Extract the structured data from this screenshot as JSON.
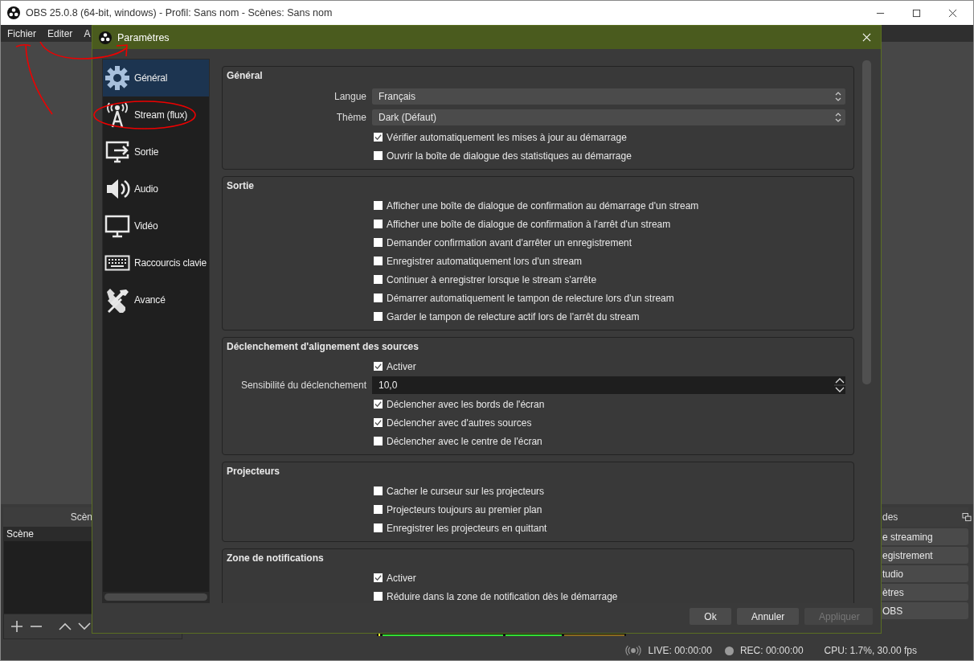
{
  "main_window": {
    "title": "OBS 25.0.8 (64-bit, windows) - Profil: Sans nom - Scènes: Sans nom"
  },
  "menu": [
    "Fichier",
    "Editer",
    "A"
  ],
  "scenes_dock": {
    "title": "Scèn",
    "items": [
      {
        "label": "Scène",
        "selected": false
      }
    ]
  },
  "controls_dock": {
    "title": "des",
    "buttons": [
      "e streaming",
      "egistrement",
      "tudio",
      "ètres",
      "OBS"
    ]
  },
  "status_bar": {
    "live": "LIVE: 00:00:00",
    "rec": "REC: 00:00:00",
    "cpu": "CPU: 1.7%, 30.00 fps"
  },
  "dialog": {
    "title": "Paramètres",
    "sidebar": [
      {
        "label": "Général",
        "selected": true
      },
      {
        "label": "Stream (flux)",
        "selected": false
      },
      {
        "label": "Sortie",
        "selected": false
      },
      {
        "label": "Audio",
        "selected": false
      },
      {
        "label": "Vidéo",
        "selected": false
      },
      {
        "label": "Raccourcis clavie",
        "selected": false
      },
      {
        "label": "Avancé",
        "selected": false
      }
    ],
    "groups": [
      {
        "title": "Général",
        "rows": [
          {
            "kind": "select",
            "label": "Langue",
            "value": "Français"
          },
          {
            "kind": "select",
            "label": "Thème",
            "value": "Dark (Défaut)"
          },
          {
            "kind": "checkbox",
            "label": "Vérifier automatiquement les mises à jour au démarrage",
            "checked": true
          },
          {
            "kind": "checkbox",
            "label": "Ouvrir la boîte de dialogue des statistiques au démarrage",
            "checked": false
          }
        ]
      },
      {
        "title": "Sortie",
        "rows": [
          {
            "kind": "checkbox",
            "label": "Afficher une boîte de dialogue de confirmation au démarrage d'un stream",
            "checked": false
          },
          {
            "kind": "checkbox",
            "label": "Afficher une boîte de dialogue de confirmation à l'arrêt d'un stream",
            "checked": false
          },
          {
            "kind": "checkbox",
            "label": "Demander confirmation avant d'arrêter un enregistrement",
            "checked": false
          },
          {
            "kind": "checkbox",
            "label": "Enregistrer automatiquement lors d'un stream",
            "checked": false
          },
          {
            "kind": "checkbox",
            "label": "Continuer à enregistrer lorsque le stream s'arrête",
            "checked": false
          },
          {
            "kind": "checkbox",
            "label": "Démarrer automatiquement le tampon de relecture lors d'un stream",
            "checked": false
          },
          {
            "kind": "checkbox",
            "label": "Garder le tampon de relecture actif lors de l'arrêt du stream",
            "checked": false
          }
        ]
      },
      {
        "title": "Déclenchement d'alignement des sources",
        "rows": [
          {
            "kind": "checkbox",
            "label": "Activer",
            "checked": true
          },
          {
            "kind": "spin",
            "label": "Sensibilité du déclenchement",
            "value": "10,0"
          },
          {
            "kind": "checkbox",
            "label": "Déclencher avec les bords de l'écran",
            "checked": true
          },
          {
            "kind": "checkbox",
            "label": "Déclencher avec d'autres sources",
            "checked": true
          },
          {
            "kind": "checkbox",
            "label": "Déclencher avec le centre de l'écran",
            "checked": false
          }
        ]
      },
      {
        "title": "Projecteurs",
        "rows": [
          {
            "kind": "checkbox",
            "label": "Cacher le curseur sur les projecteurs",
            "checked": false
          },
          {
            "kind": "checkbox",
            "label": "Projecteurs toujours au premier plan",
            "checked": false
          },
          {
            "kind": "checkbox",
            "label": "Enregistrer les projecteurs en quittant",
            "checked": false
          }
        ]
      },
      {
        "title": "Zone de notifications",
        "rows": [
          {
            "kind": "checkbox",
            "label": "Activer",
            "checked": true
          },
          {
            "kind": "checkbox",
            "label": "Réduire dans la zone de notification dès le démarrage",
            "checked": false
          }
        ]
      }
    ],
    "buttons": [
      {
        "label": "Ok",
        "disabled": false
      },
      {
        "label": "Annuler",
        "disabled": false
      },
      {
        "label": "Appliquer",
        "disabled": true
      }
    ]
  }
}
